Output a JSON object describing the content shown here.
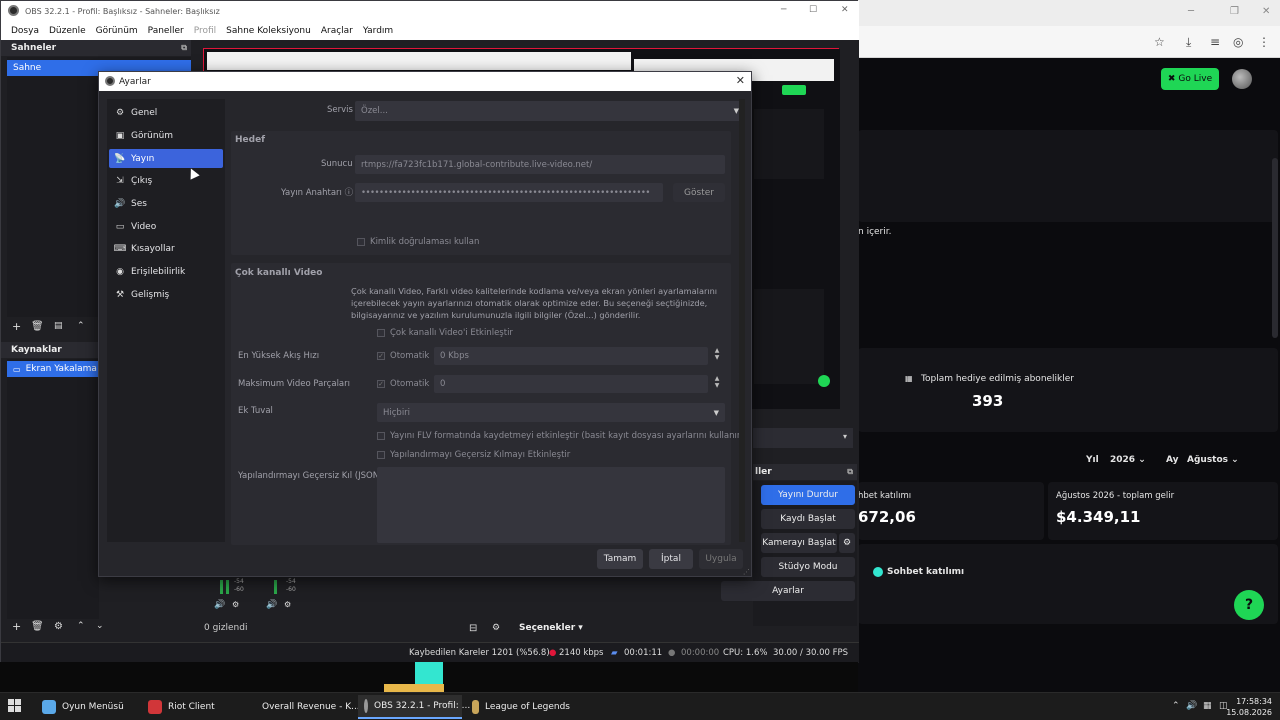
{
  "obs": {
    "title": "OBS 32.2.1 - Profil: Başlıksız - Sahneler: Başlıksız",
    "menu": [
      "Dosya",
      "Düzenle",
      "Görünüm",
      "Paneller",
      "Profil",
      "Sahne Koleksiyonu",
      "Araçlar",
      "Yardım"
    ],
    "scenes_header": "Sahneler",
    "scene_selected": "Sahne",
    "sources_header": "Kaynaklar",
    "source_selected": "Ekran Yakalama",
    "hidden_count": "0 gizlendi",
    "options_label": "Seçenekler",
    "controls_header": "ller",
    "controls": {
      "stop_stream": "Yayını Durdur",
      "start_record": "Kaydı Başlat",
      "start_camera": "Kamerayı Başlat",
      "studio_mode": "Stüdyo Modu",
      "settings": "Ayarlar"
    },
    "mixer_levels": [
      "-54",
      "-60",
      "-54",
      "-60"
    ],
    "status": {
      "dropped_frames": "Kaybedilen Kareler 1201 (%56.8)",
      "bitrate": "2140 kbps",
      "stream_time": "00:01:11",
      "record_time": "00:00:00",
      "cpu": "CPU: 1.6%",
      "fps": "30.00 / 30.00 FPS"
    }
  },
  "settings": {
    "title": "Ayarlar",
    "nav": [
      "Genel",
      "Görünüm",
      "Yayın",
      "Çıkış",
      "Ses",
      "Video",
      "Kısayollar",
      "Erişilebilirlik",
      "Gelişmiş"
    ],
    "nav_icons": [
      "gear-icon",
      "monitor-icon",
      "antenna-icon",
      "output-icon",
      "speaker-icon",
      "video-icon",
      "keyboard-icon",
      "accessibility-icon",
      "tools-icon"
    ],
    "selected_nav": "Yayın",
    "service_label": "Servis",
    "service_value": "Özel...",
    "target_title": "Hedef",
    "server_label": "Sunucu",
    "server_value": "rtmps://fa723fc1b171.global-contribute.live-video.net/",
    "key_label": "Yayın Anahtarı",
    "key_value": "••••••••••••••••••••••••••••••••••••••••••••••••••••••••••••••••",
    "show_button": "Göster",
    "auth_checkbox": "Kimlik doğrulaması kullan",
    "multitrack_title": "Çok kanallı Video",
    "multitrack_desc": "Çok kanallı Video, Farklı video kalitelerinde kodlama ve/veya ekran yönleri ayarlamalarını içerebilecek yayın ayarlarınızı otomatik olarak optimize eder. Bu seçeneği seçtiğinizde, bilgisayarınız ve yazılım kurulumunuzla ilgili bilgiler (Özel...) gönderilir.",
    "multitrack_enable": "Çok kanallı Video'i Etkinleştir",
    "max_bitrate_label": "En Yüksek Akış Hızı",
    "max_bitrate_auto": "Otomatik",
    "max_bitrate_value": "0 Kbps",
    "max_tracks_label": "Maksimum Video Parçaları",
    "max_tracks_auto": "Otomatik",
    "max_tracks_value": "0",
    "extra_canvas_label": "Ek Tuval",
    "extra_canvas_value": "Hiçbiri",
    "flv_checkbox": "Yayını FLV formatında kaydetmeyi etkinleştir (basit kayıt dosyası ayarlarını kullanır)",
    "override_checkbox": "Yapılandırmayı Geçersiz Kılmayı Etkinleştir",
    "override_json_label": "Yapılandırmayı Geçersiz Kıl (JSON)",
    "ok": "Tamam",
    "cancel": "İptal",
    "apply": "Uygula"
  },
  "browser": {
    "go_live": "Go Live",
    "partial_text": "n içerir.",
    "subs_label": "Toplam hediye edilmiş abonelikler",
    "subs_value": "393",
    "year_label": "Yıl",
    "year_value": "2026",
    "month_label": "Ay",
    "month_value": "Ağustos",
    "chat_partial": "hbet katılımı",
    "chat_value": "672,06",
    "revenue_label": "Ağustos 2026 - toplam gelir",
    "revenue_value": "$4.349,11",
    "chat_legend": "Sohbet katılımı"
  },
  "taskbar": {
    "items": [
      "Oyun Menüsü",
      "Riot Client",
      "Overall Revenue - K...",
      "OBS 32.2.1 - Profil: ...",
      "League of Legends"
    ],
    "time": "17:58:34",
    "date": "15.08.2026"
  }
}
